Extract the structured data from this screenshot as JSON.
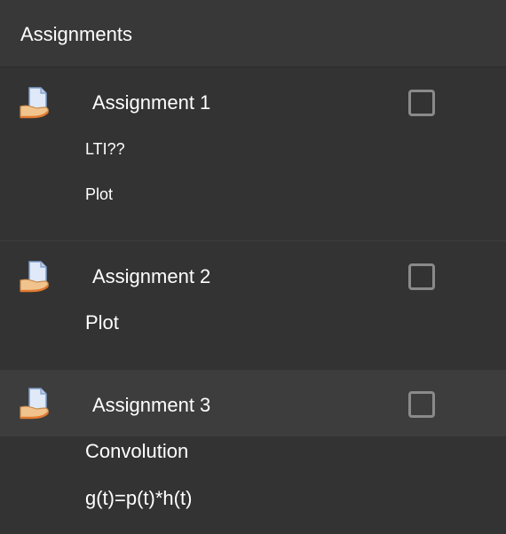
{
  "header": {
    "title": "Assignments"
  },
  "assignments": [
    {
      "icon": "assignment-icon",
      "title": "Assignment 1",
      "completed": false,
      "description": [
        "LTI??",
        "Plot"
      ]
    },
    {
      "icon": "assignment-icon",
      "title": "Assignment 2",
      "completed": false,
      "description": [
        "Plot"
      ]
    },
    {
      "icon": "assignment-icon",
      "title": "Assignment 3",
      "completed": false,
      "description": [
        "Convolution",
        "g(t)=p(t)*h(t)"
      ]
    }
  ],
  "colors": {
    "background": "#333333",
    "header_background": "#383838",
    "highlight": "#3d3d3d",
    "checkbox_border": "#8a8a8a",
    "text": "#ffffff"
  }
}
